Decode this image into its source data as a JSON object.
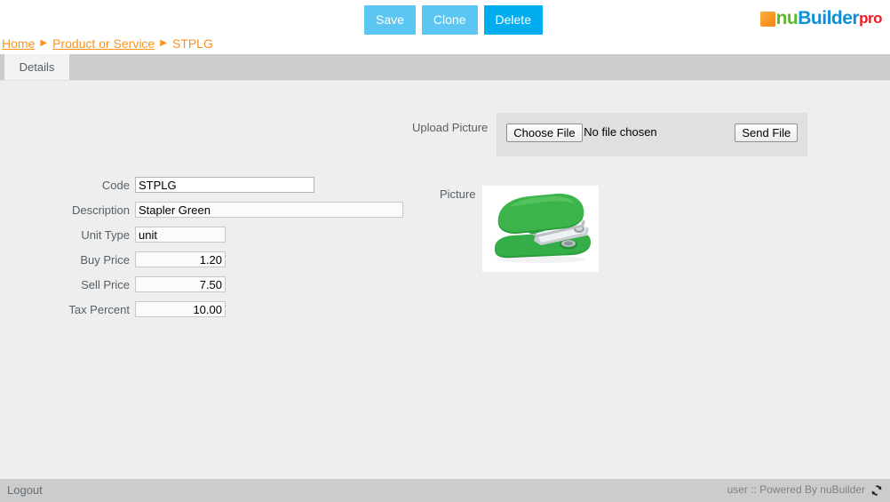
{
  "toolbar": {
    "save_label": "Save",
    "clone_label": "Clone",
    "delete_label": "Delete",
    "colors": {
      "save": "#5bc6f2",
      "clone": "#5bc6f2",
      "delete": "#00aeef"
    }
  },
  "logo": {
    "square_icon": "orange-square-icon",
    "part_nu": "nu",
    "part_builder": "Builder",
    "part_pro": "pro",
    "colors": {
      "square": "#f7941e",
      "nu": "#5cb82b",
      "builder": "#0d8fd9",
      "pro": "#ed1c24"
    }
  },
  "breadcrumb": {
    "home": "Home",
    "separator": "▶",
    "section": "Product or Service",
    "current": "STPLG",
    "color": "#f7941e"
  },
  "tabs": [
    {
      "label": "Details",
      "active": true
    }
  ],
  "upload": {
    "label": "Upload Picture",
    "choose_file_label": "Choose File",
    "no_file_text": "No file chosen",
    "send_file_label": "Send File"
  },
  "form": {
    "fields": [
      {
        "label": "Code",
        "value": "STPLG",
        "align": "left",
        "width": "w-code",
        "focused": true
      },
      {
        "label": "Description",
        "value": "Stapler Green",
        "align": "left",
        "width": "w-desc",
        "focused": false
      },
      {
        "label": "Unit Type",
        "value": "unit",
        "align": "left",
        "width": "w-unit",
        "focused": false
      },
      {
        "label": "Buy Price",
        "value": "1.20",
        "align": "right",
        "width": "w-num",
        "focused": false
      },
      {
        "label": "Sell Price",
        "value": "7.50",
        "align": "right",
        "width": "w-num",
        "focused": false
      },
      {
        "label": "Tax Percent",
        "value": "10.00",
        "align": "right",
        "width": "w-num",
        "focused": false
      }
    ]
  },
  "picture": {
    "label": "Picture",
    "image_alt": "green-stapler-image",
    "body_color": "#2aa13c",
    "metal_color": "#d8dcdf"
  },
  "footer": {
    "logout_label": "Logout",
    "status_text": "user :: Powered By nuBuilder",
    "refresh_icon": "refresh-icon"
  }
}
